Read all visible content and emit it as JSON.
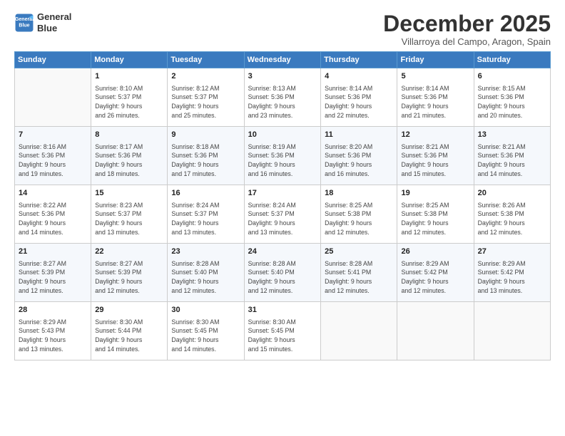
{
  "header": {
    "logo_line1": "General",
    "logo_line2": "Blue",
    "month": "December 2025",
    "location": "Villarroya del Campo, Aragon, Spain"
  },
  "weekdays": [
    "Sunday",
    "Monday",
    "Tuesday",
    "Wednesday",
    "Thursday",
    "Friday",
    "Saturday"
  ],
  "weeks": [
    [
      {
        "num": "",
        "info": ""
      },
      {
        "num": "1",
        "info": "Sunrise: 8:10 AM\nSunset: 5:37 PM\nDaylight: 9 hours\nand 26 minutes."
      },
      {
        "num": "2",
        "info": "Sunrise: 8:12 AM\nSunset: 5:37 PM\nDaylight: 9 hours\nand 25 minutes."
      },
      {
        "num": "3",
        "info": "Sunrise: 8:13 AM\nSunset: 5:36 PM\nDaylight: 9 hours\nand 23 minutes."
      },
      {
        "num": "4",
        "info": "Sunrise: 8:14 AM\nSunset: 5:36 PM\nDaylight: 9 hours\nand 22 minutes."
      },
      {
        "num": "5",
        "info": "Sunrise: 8:14 AM\nSunset: 5:36 PM\nDaylight: 9 hours\nand 21 minutes."
      },
      {
        "num": "6",
        "info": "Sunrise: 8:15 AM\nSunset: 5:36 PM\nDaylight: 9 hours\nand 20 minutes."
      }
    ],
    [
      {
        "num": "7",
        "info": "Sunrise: 8:16 AM\nSunset: 5:36 PM\nDaylight: 9 hours\nand 19 minutes."
      },
      {
        "num": "8",
        "info": "Sunrise: 8:17 AM\nSunset: 5:36 PM\nDaylight: 9 hours\nand 18 minutes."
      },
      {
        "num": "9",
        "info": "Sunrise: 8:18 AM\nSunset: 5:36 PM\nDaylight: 9 hours\nand 17 minutes."
      },
      {
        "num": "10",
        "info": "Sunrise: 8:19 AM\nSunset: 5:36 PM\nDaylight: 9 hours\nand 16 minutes."
      },
      {
        "num": "11",
        "info": "Sunrise: 8:20 AM\nSunset: 5:36 PM\nDaylight: 9 hours\nand 16 minutes."
      },
      {
        "num": "12",
        "info": "Sunrise: 8:21 AM\nSunset: 5:36 PM\nDaylight: 9 hours\nand 15 minutes."
      },
      {
        "num": "13",
        "info": "Sunrise: 8:21 AM\nSunset: 5:36 PM\nDaylight: 9 hours\nand 14 minutes."
      }
    ],
    [
      {
        "num": "14",
        "info": "Sunrise: 8:22 AM\nSunset: 5:36 PM\nDaylight: 9 hours\nand 14 minutes."
      },
      {
        "num": "15",
        "info": "Sunrise: 8:23 AM\nSunset: 5:37 PM\nDaylight: 9 hours\nand 13 minutes."
      },
      {
        "num": "16",
        "info": "Sunrise: 8:24 AM\nSunset: 5:37 PM\nDaylight: 9 hours\nand 13 minutes."
      },
      {
        "num": "17",
        "info": "Sunrise: 8:24 AM\nSunset: 5:37 PM\nDaylight: 9 hours\nand 13 minutes."
      },
      {
        "num": "18",
        "info": "Sunrise: 8:25 AM\nSunset: 5:38 PM\nDaylight: 9 hours\nand 12 minutes."
      },
      {
        "num": "19",
        "info": "Sunrise: 8:25 AM\nSunset: 5:38 PM\nDaylight: 9 hours\nand 12 minutes."
      },
      {
        "num": "20",
        "info": "Sunrise: 8:26 AM\nSunset: 5:38 PM\nDaylight: 9 hours\nand 12 minutes."
      }
    ],
    [
      {
        "num": "21",
        "info": "Sunrise: 8:27 AM\nSunset: 5:39 PM\nDaylight: 9 hours\nand 12 minutes."
      },
      {
        "num": "22",
        "info": "Sunrise: 8:27 AM\nSunset: 5:39 PM\nDaylight: 9 hours\nand 12 minutes."
      },
      {
        "num": "23",
        "info": "Sunrise: 8:28 AM\nSunset: 5:40 PM\nDaylight: 9 hours\nand 12 minutes."
      },
      {
        "num": "24",
        "info": "Sunrise: 8:28 AM\nSunset: 5:40 PM\nDaylight: 9 hours\nand 12 minutes."
      },
      {
        "num": "25",
        "info": "Sunrise: 8:28 AM\nSunset: 5:41 PM\nDaylight: 9 hours\nand 12 minutes."
      },
      {
        "num": "26",
        "info": "Sunrise: 8:29 AM\nSunset: 5:42 PM\nDaylight: 9 hours\nand 12 minutes."
      },
      {
        "num": "27",
        "info": "Sunrise: 8:29 AM\nSunset: 5:42 PM\nDaylight: 9 hours\nand 13 minutes."
      }
    ],
    [
      {
        "num": "28",
        "info": "Sunrise: 8:29 AM\nSunset: 5:43 PM\nDaylight: 9 hours\nand 13 minutes."
      },
      {
        "num": "29",
        "info": "Sunrise: 8:30 AM\nSunset: 5:44 PM\nDaylight: 9 hours\nand 14 minutes."
      },
      {
        "num": "30",
        "info": "Sunrise: 8:30 AM\nSunset: 5:45 PM\nDaylight: 9 hours\nand 14 minutes."
      },
      {
        "num": "31",
        "info": "Sunrise: 8:30 AM\nSunset: 5:45 PM\nDaylight: 9 hours\nand 15 minutes."
      },
      {
        "num": "",
        "info": ""
      },
      {
        "num": "",
        "info": ""
      },
      {
        "num": "",
        "info": ""
      }
    ]
  ]
}
